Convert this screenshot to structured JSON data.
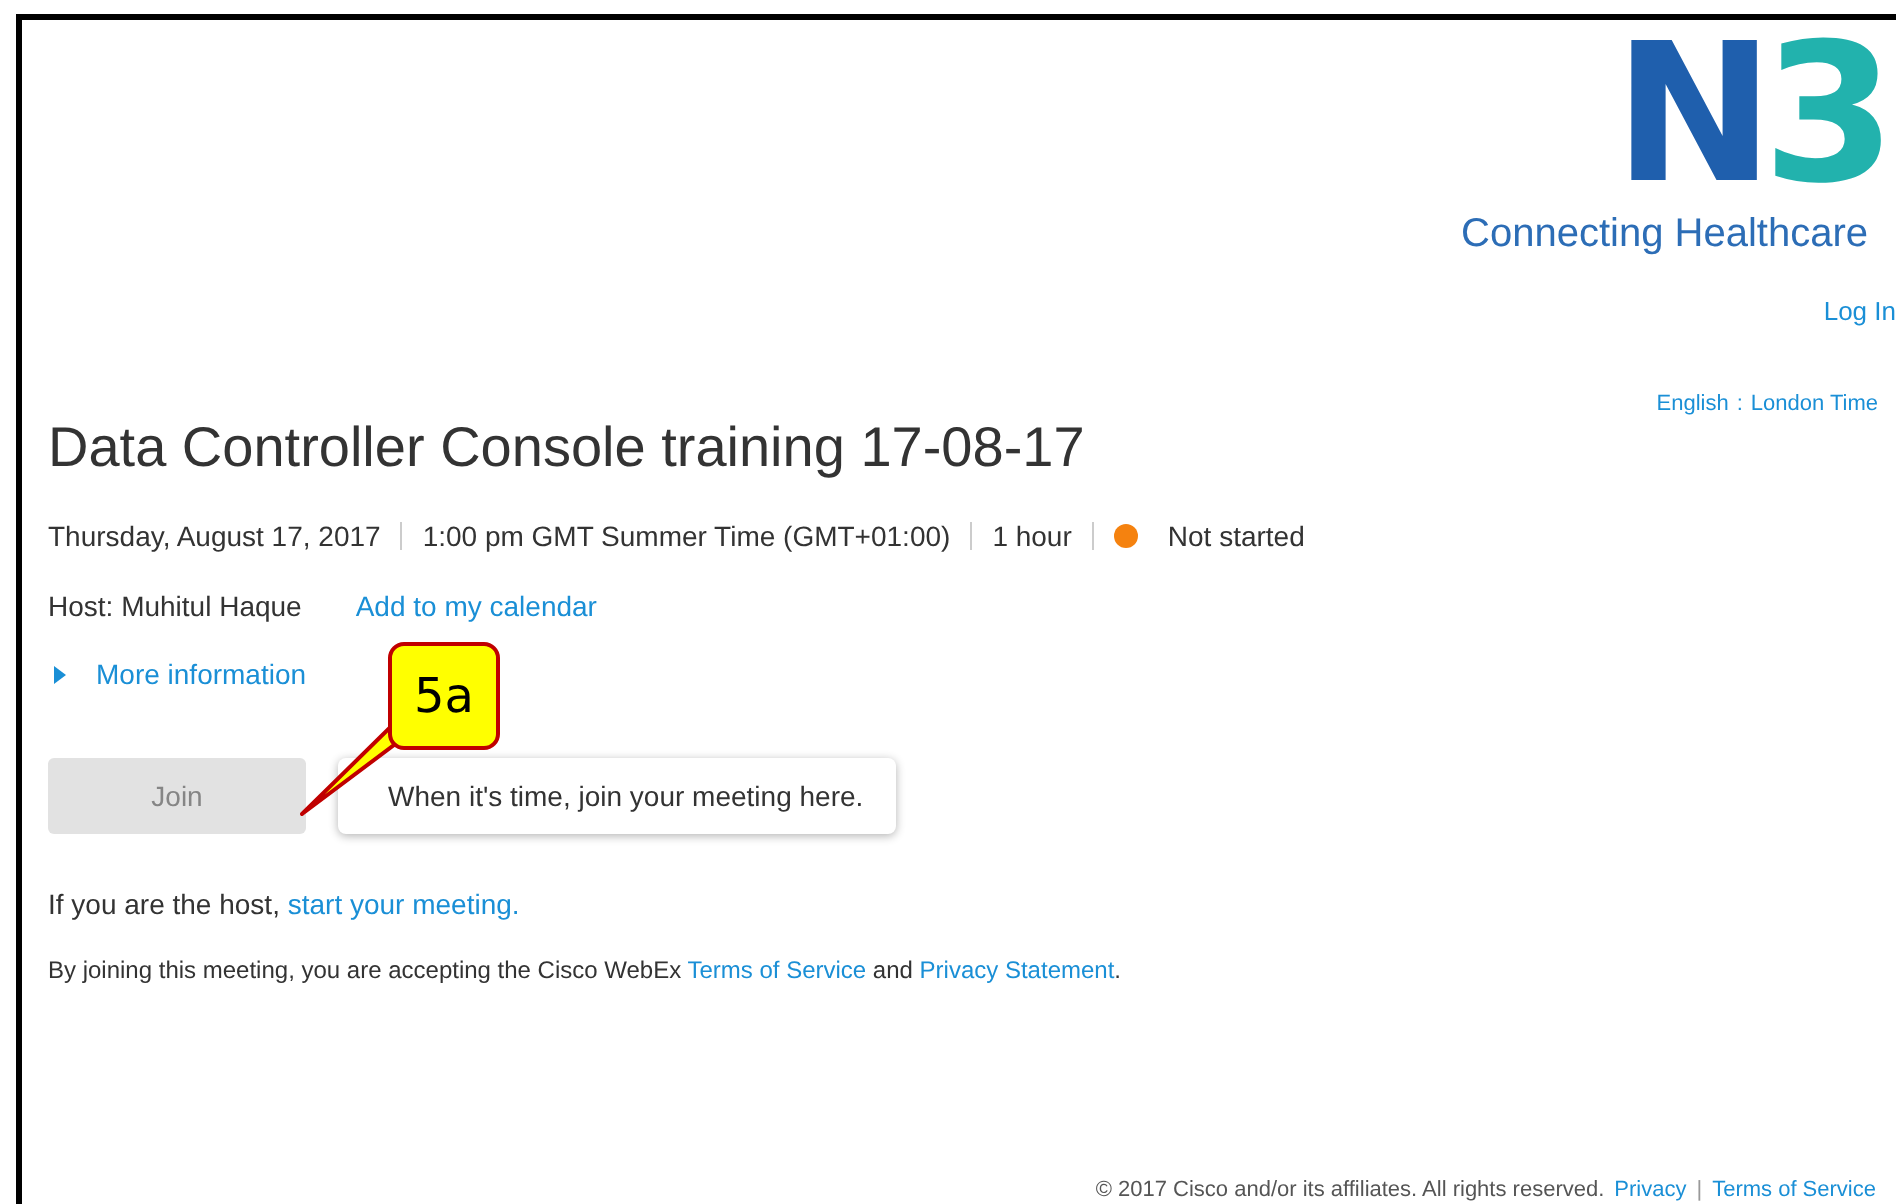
{
  "logo": {
    "letter": "N",
    "digit": "3",
    "tagline": "Connecting Healthcare"
  },
  "login": "Log In",
  "locale": {
    "language": "English",
    "separator": ":",
    "timezone": "London Time"
  },
  "meeting": {
    "title": "Data Controller Console training 17-08-17",
    "date": "Thursday, August 17, 2017",
    "time": "1:00 pm GMT Summer Time (GMT+01:00)",
    "duration": "1 hour",
    "status": {
      "label": "Not started",
      "color": "#f5820f"
    },
    "host": "Host: Muhitul Haque",
    "calendar_link": "Add to my calendar",
    "more_info": {
      "label": "More information",
      "expanded": false
    }
  },
  "join_button": {
    "label": "Join",
    "disabled": true
  },
  "tooltip": "When it's time, join your meeting here.",
  "callout": "5a",
  "host_line": {
    "text": "If you are the host,",
    "link": "start your meeting."
  },
  "terms_line": {
    "text": "By joining this meeting, you are accepting the Cisco WebEx",
    "link1": "Terms of Service",
    "and": "and",
    "link2": "Privacy Statement",
    "end": "."
  },
  "footer": {
    "copyright": "© 2017 Cisco and/or its affiliates. All rights reserved.",
    "privacy": "Privacy",
    "separator": "|",
    "terms": "Terms of Service"
  }
}
